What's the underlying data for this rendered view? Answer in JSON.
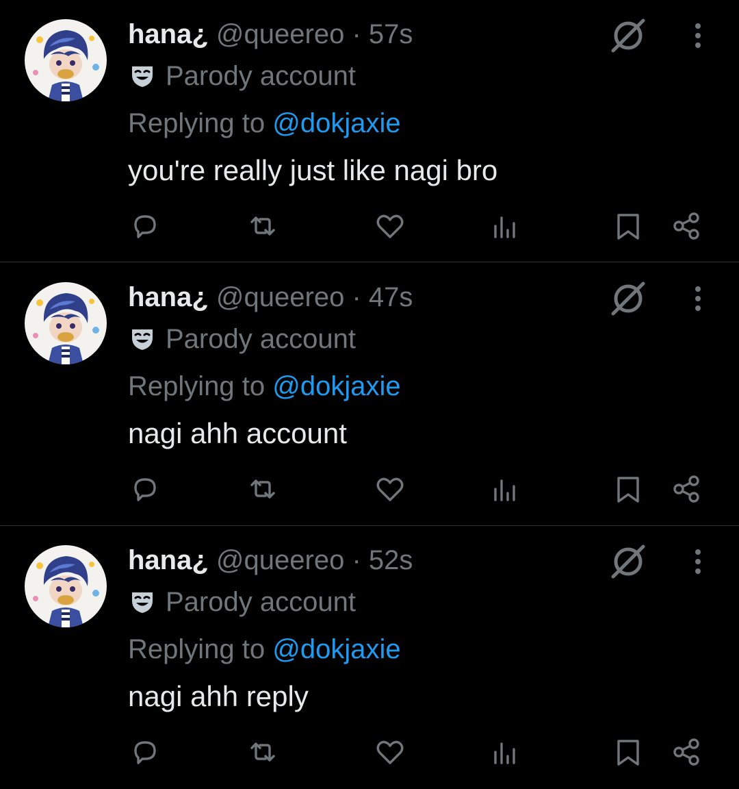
{
  "tweets": [
    {
      "display_name": "hana¿",
      "handle": "@queereo",
      "separator": "·",
      "time": "57s",
      "badge_label": "Parody account",
      "replying_prefix": "Replying to",
      "replying_to": "@dokjaxie",
      "text": "you're really just like nagi bro"
    },
    {
      "display_name": "hana¿",
      "handle": "@queereo",
      "separator": "·",
      "time": "47s",
      "badge_label": "Parody account",
      "replying_prefix": "Replying to",
      "replying_to": "@dokjaxie",
      "text": "nagi ahh account"
    },
    {
      "display_name": "hana¿",
      "handle": "@queereo",
      "separator": "·",
      "time": "52s",
      "badge_label": "Parody account",
      "replying_prefix": "Replying to",
      "replying_to": "@dokjaxie",
      "text": "nagi ahh reply"
    }
  ],
  "icons": {
    "header_right": [
      "grok-icon",
      "more-options-icon"
    ],
    "actions": [
      "reply-icon",
      "retweet-icon",
      "like-icon",
      "views-icon",
      "bookmark-icon",
      "share-icon"
    ],
    "badge": "parody-mask-icon"
  },
  "colors": {
    "background": "#000000",
    "primary_text": "#e7e9ea",
    "secondary_text": "#71767b",
    "link": "#1d9bf0",
    "divider": "#2f3336",
    "badge_icon": "#c4cfd6"
  }
}
